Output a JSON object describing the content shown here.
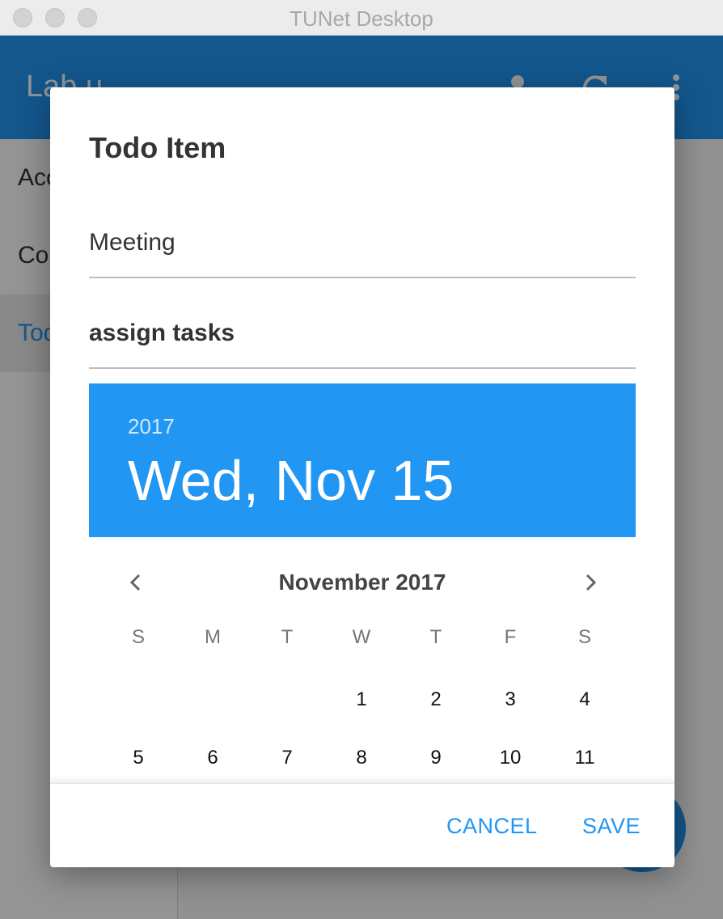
{
  "window": {
    "title": "TUNet Desktop"
  },
  "appbar": {
    "title": "Lab u",
    "icons": [
      "account-icon",
      "refresh-icon",
      "more-vert-icon"
    ]
  },
  "sidebar": {
    "items": [
      {
        "label": "Acc"
      },
      {
        "label": "Co"
      },
      {
        "label": "Tod",
        "active": true
      }
    ]
  },
  "dialog": {
    "title": "Todo Item",
    "title_field_value": "Meeting",
    "description_field_value": "assign tasks",
    "date_header": {
      "year": "2017",
      "full_date": "Wed, Nov 15"
    },
    "calendar": {
      "month_label": "November 2017",
      "weekdays": [
        "S",
        "M",
        "T",
        "W",
        "T",
        "F",
        "S"
      ],
      "weeks": [
        [
          "",
          "",
          "",
          "1",
          "2",
          "3",
          "4"
        ],
        [
          "5",
          "6",
          "7",
          "8",
          "9",
          "10",
          "11"
        ]
      ]
    },
    "actions": {
      "cancel_label": "CANCEL",
      "save_label": "SAVE"
    }
  },
  "colors": {
    "accent": "#2196f3",
    "text": "#333333"
  }
}
